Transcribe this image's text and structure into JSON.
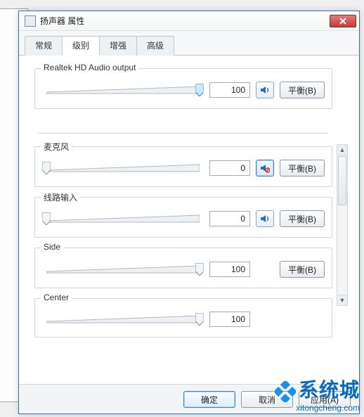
{
  "window": {
    "title": "扬声器 属性"
  },
  "tabs": {
    "general": "常规",
    "levels": "级别",
    "enhance": "增强",
    "advanced": "高级"
  },
  "groups": {
    "output": {
      "label": "Realtek HD Audio output",
      "value": "100",
      "percent": 100,
      "balance": "平衡(B)"
    },
    "mic": {
      "label": "麦克风",
      "value": "0",
      "percent": 0,
      "balance": "平衡(B)"
    },
    "linein": {
      "label": "线路输入",
      "value": "0",
      "percent": 0,
      "balance": "平衡(B)"
    },
    "side": {
      "label": "Side",
      "value": "100",
      "percent": 100,
      "balance": "平衡(B)"
    },
    "center": {
      "label": "Center",
      "value": "100",
      "percent": 100
    }
  },
  "footer": {
    "ok": "确定",
    "cancel": "取消",
    "apply": "应用(A)"
  },
  "watermark": {
    "line1": "系统城",
    "line2": "xitongcheng.com"
  }
}
